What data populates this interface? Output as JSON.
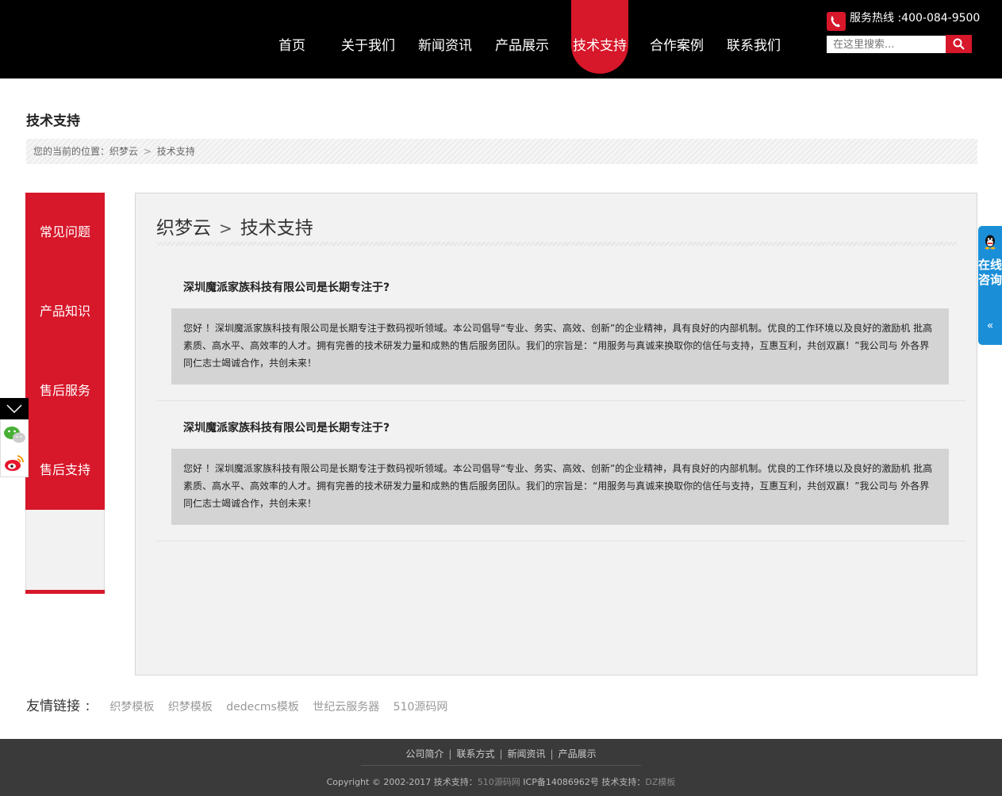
{
  "nav": {
    "items": [
      {
        "label": "首页"
      },
      {
        "label": "关于我们"
      },
      {
        "label": "新闻资讯"
      },
      {
        "label": "产品展示"
      },
      {
        "label": "技术支持"
      },
      {
        "label": "合作案例"
      },
      {
        "label": "联系我们"
      }
    ],
    "active_index": 4
  },
  "hotline": {
    "text": "服务热线 :400-084-9500"
  },
  "search": {
    "placeholder": "在这里搜索..."
  },
  "page": {
    "title": "技术支持"
  },
  "breadcrumb": {
    "prefix": "您的当前的位置：",
    "home": "织梦云",
    "sep": ">",
    "current": "技术支持"
  },
  "sidebar": {
    "items": [
      {
        "label": "常见问题"
      },
      {
        "label": "产品知识"
      },
      {
        "label": "售后服务"
      },
      {
        "label": "售后支持"
      }
    ]
  },
  "main": {
    "head_home": "织梦云",
    "head_sep": ">",
    "head_current": "技术支持",
    "faqs": [
      {
        "question": "深圳魔派家族科技有限公司是长期专注于?",
        "answer": "您好 ！深圳魔派家族科技有限公司是长期专注于数码视听领域。本公司倡导“专业、务实、高效、创新”的企业精神，具有良好的内部机制。优良的工作环境以及良好的激励机 批高素质、高水平、高效率的人才。拥有完善的技术研发力量和成熟的售后服务团队。我们的宗旨是：“用服务与真诚来换取你的信任与支持，互惠互利，共创双赢！”我公司与 外各界同仁志士竭诚合作，共创未来！"
      },
      {
        "question": "深圳魔派家族科技有限公司是长期专注于?",
        "answer": "您好 ！深圳魔派家族科技有限公司是长期专注于数码视听领域。本公司倡导“专业、务实、高效、创新”的企业精神，具有良好的内部机制。优良的工作环境以及良好的激励机 批高素质、高水平、高效率的人才。拥有完善的技术研发力量和成熟的售后服务团队。我们的宗旨是：“用服务与真诚来换取你的信任与支持，互惠互利，共创双赢！”我公司与 外各界同仁志士竭诚合作，共创未来！"
      }
    ]
  },
  "consult": {
    "text": "在线咨询",
    "arrow": "«"
  },
  "links": {
    "title": "友情链接",
    "colon": "：",
    "items": [
      "织梦模板",
      "织梦模板",
      "dedecms模板",
      "世纪云服务器",
      "510源码网"
    ]
  },
  "footer": {
    "nav": [
      "公司简介",
      "联系方式",
      "新闻资讯",
      "产品展示"
    ],
    "bar": "|",
    "copy_prefix": "Copyright © 2002-2017 技术支持：",
    "copy_link1": "510源码网",
    "copy_icp": " ICP备14086962号 技术支持：",
    "copy_link2": "DZ模板"
  },
  "colors": {
    "accent": "#d7172a",
    "header_bg": "#000000",
    "consult_bg": "#1a8fd8",
    "footer_bg": "#3a3a3a"
  },
  "icons": [
    "phone-icon",
    "search-icon",
    "wechat-icon",
    "weibo-icon",
    "chevron-down-icon",
    "qq-icon"
  ]
}
